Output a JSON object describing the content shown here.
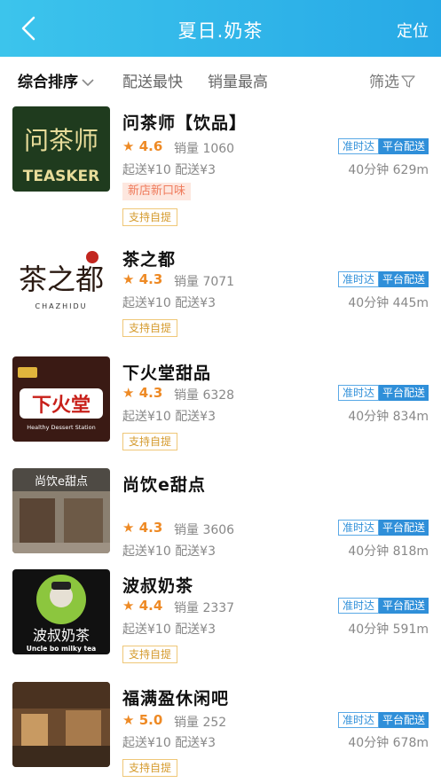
{
  "header": {
    "title": "夏日.奶茶",
    "locate_label": "定位"
  },
  "filters": {
    "sort": "综合排序",
    "fastest": "配送最快",
    "top_sales": "销量最高",
    "filter": "筛选"
  },
  "shops": [
    {
      "name": "问茶师【饮品】",
      "rating": "4.6",
      "sales": "销量 1060",
      "min_order": "起送¥10",
      "delivery": "配送¥3",
      "time": "40分钟",
      "distance": "629m",
      "badge_ontime": "准时达",
      "badge_platform": "平台配送",
      "promo": "新店新口味",
      "pickup": "支持自提",
      "logo_text": "问茶师",
      "logo_sub": "TEASKER"
    },
    {
      "name": "茶之都",
      "rating": "4.3",
      "sales": "销量 7071",
      "min_order": "起送¥10",
      "delivery": "配送¥3",
      "time": "40分钟",
      "distance": "445m",
      "badge_ontime": "准时达",
      "badge_platform": "平台配送",
      "pickup": "支持自提",
      "logo_text": "茶之都",
      "logo_sub": "CHAZHIDU"
    },
    {
      "name": "下火堂甜品",
      "rating": "4.3",
      "sales": "销量 6328",
      "min_order": "起送¥10",
      "delivery": "配送¥3",
      "time": "40分钟",
      "distance": "834m",
      "badge_ontime": "准时达",
      "badge_platform": "平台配送",
      "pickup": "支持自提",
      "logo_text": "下火堂",
      "logo_sub": "Healthy Dessert Station"
    },
    {
      "name": "尚饮e甜点",
      "rating": "4.3",
      "sales": "销量 3606",
      "min_order": "起送¥10",
      "delivery": "配送¥3",
      "time": "40分钟",
      "distance": "818m",
      "badge_ontime": "准时达",
      "badge_platform": "平台配送",
      "logo_text": "尚饮e甜点"
    },
    {
      "name": "波叔奶茶",
      "rating": "4.4",
      "sales": "销量 2337",
      "min_order": "起送¥10",
      "delivery": "配送¥3",
      "time": "40分钟",
      "distance": "591m",
      "badge_ontime": "准时达",
      "badge_platform": "平台配送",
      "pickup": "支持自提",
      "logo_text": "波叔奶茶",
      "logo_sub": "Uncle bo milky tea"
    },
    {
      "name": "福满盈休闲吧",
      "rating": "5.0",
      "sales": "销量 252",
      "min_order": "起送¥10",
      "delivery": "配送¥3",
      "time": "40分钟",
      "distance": "678m",
      "badge_ontime": "准时达",
      "badge_platform": "平台配送",
      "pickup": "支持自提"
    }
  ],
  "colors": {
    "header_start": "#3cc4ec",
    "header_end": "#27a9e6",
    "star": "#ee8a25",
    "platform_badge": "#2f8fd9"
  },
  "icons": {
    "back": "chevron-left-icon",
    "sort_toggle": "chevron-down-icon",
    "filter": "funnel-icon",
    "rating": "star-icon"
  }
}
